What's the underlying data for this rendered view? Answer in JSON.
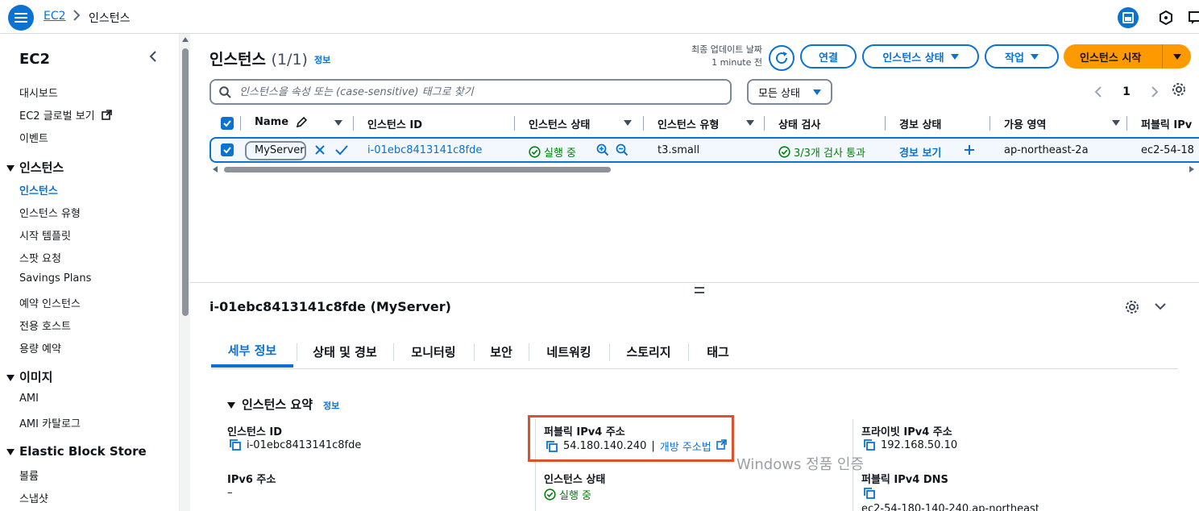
{
  "breadcrumb": {
    "root": "EC2",
    "current": "인스턴스"
  },
  "sidebar": {
    "title": "EC2",
    "items_top": [
      "대시보드",
      "EC2 글로벌 보기",
      "이벤트"
    ],
    "section_instances": "인스턴스",
    "instances_items": [
      "인스턴스",
      "인스턴스 유형",
      "시작 템플릿",
      "스팟 요청",
      "Savings Plans",
      "예약 인스턴스",
      "전용 호스트",
      "용량 예약"
    ],
    "section_images": "이미지",
    "images_items": [
      "AMI",
      "AMI 카탈로그"
    ],
    "section_ebs": "Elastic Block Store",
    "ebs_items": [
      "볼륨",
      "스냅샷"
    ]
  },
  "panel": {
    "title": "인스턴스",
    "count": "(1/1)",
    "info": "정보",
    "last_update_label": "최종 업데이트 날짜",
    "last_update_value": "1 minute 전",
    "connect": "연결",
    "instance_state": "인스턴스 상태",
    "actions": "작업",
    "launch": "인스턴스 시작",
    "search_placeholder": "인스턴스을 속성 또는 (case-sensitive) 태그로 찾기",
    "filter_select": "모든 상태",
    "page": "1"
  },
  "table": {
    "headers": [
      "Name",
      "인스턴스 ID",
      "인스턴스 상태",
      "인스턴스 유형",
      "상태 검사",
      "경보 상태",
      "가용 영역",
      "퍼블릭 IPv"
    ],
    "row": {
      "name": "MyServer",
      "instance_id": "i-01ebc8413141c8fde",
      "state": "실행 중",
      "type": "t3.small",
      "status_check": "3/3개 검사 통과",
      "alarm": "경보 보기",
      "az": "ap-northeast-2a",
      "public_dns": "ec2-54-18"
    }
  },
  "detail": {
    "title": "i-01ebc8413141c8fde (MyServer)",
    "tabs": [
      "세부 정보",
      "상태 및 경보",
      "모니터링",
      "보안",
      "네트워킹",
      "스토리지",
      "태그"
    ],
    "section": "인스턴스 요약",
    "info": "정보",
    "instance_id_label": "인스턴스 ID",
    "instance_id_value": "i-01ebc8413141c8fde",
    "ipv6_label": "IPv6 주소",
    "ipv6_value": "–",
    "public_ipv4_label": "퍼블릭 IPv4 주소",
    "public_ipv4_value": "54.180.140.240",
    "open_address": "개방 주소법",
    "state_label": "인스턴스 상태",
    "state_value": "실행 중",
    "private_ipv4_label": "프라이빗 IPv4 주소",
    "private_ipv4_value": "192.168.50.10",
    "public_dns_label": "퍼블릭 IPv4 DNS",
    "public_dns_value": "ec2-54-180-140-240.ap-northeast"
  },
  "watermark": "Windows 정품 인증",
  "colors": {
    "accent": "#0972d3",
    "primary_button": "#ff9900",
    "success": "#037f0c",
    "highlight": "#e0502b"
  }
}
